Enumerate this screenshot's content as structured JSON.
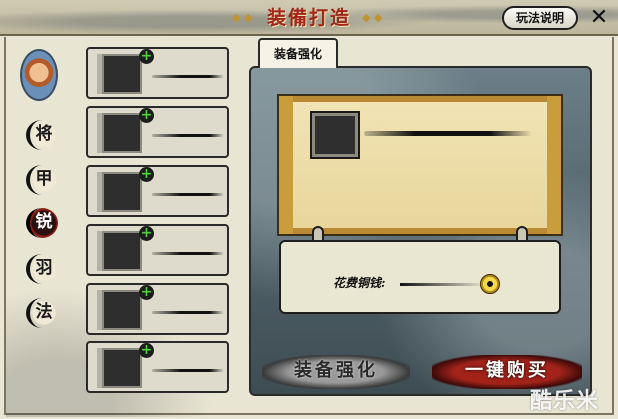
{
  "header": {
    "title": "装備打造",
    "help_label": "玩法说明",
    "close_label": "✕"
  },
  "sidebar": {
    "avatar_icon": "hero-portrait-icon",
    "categories": [
      {
        "label": "将",
        "active": false
      },
      {
        "label": "甲",
        "active": false
      },
      {
        "label": "锐",
        "active": true
      },
      {
        "label": "羽",
        "active": false
      },
      {
        "label": "法",
        "active": false
      }
    ]
  },
  "slots": {
    "count": 6,
    "plus_symbol": "+"
  },
  "tabs": [
    {
      "label": "装备强化",
      "active": true
    }
  ],
  "panel": {
    "material_label": "花费铜钱:",
    "coin_icon": "copper-coin-icon"
  },
  "actions": {
    "enhance_label": "装备强化",
    "buy_label": "一键购买"
  },
  "watermark": "酷乐米",
  "colors": {
    "title": "#a0251a",
    "active_category": "#8a1d16",
    "buy_button": "#a3231a",
    "plus": "#4fd03a"
  }
}
